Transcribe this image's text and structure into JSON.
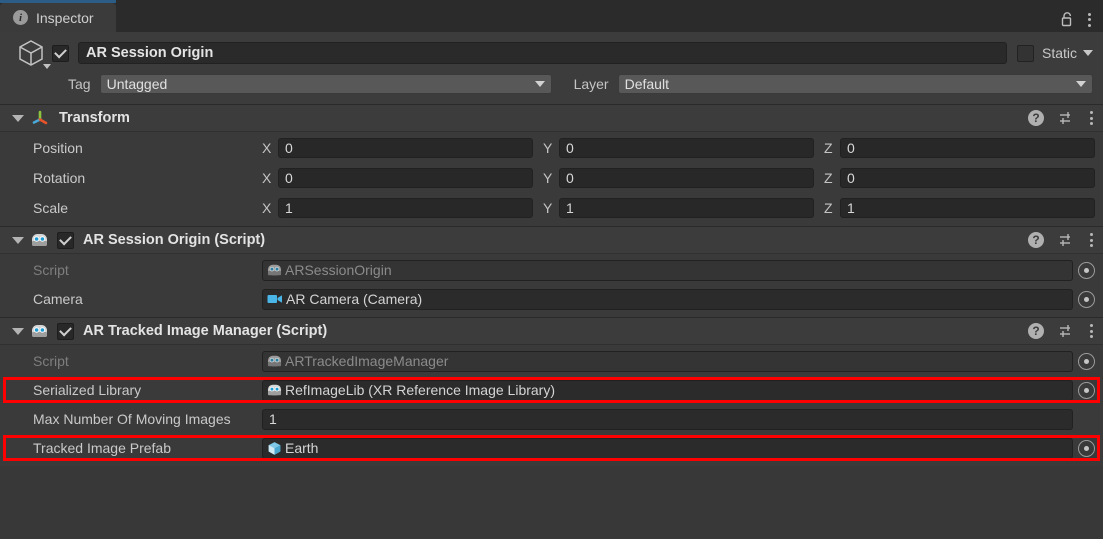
{
  "window": {
    "tab_label": "Inspector",
    "tab_icon": "info-icon",
    "lock_icon": "lock-icon",
    "menu_icon": "kebab-menu-icon"
  },
  "gameobject": {
    "enabled": true,
    "name": "AR Session Origin",
    "icon": "gameobject-cube-icon",
    "static_label": "Static",
    "static_checked": false,
    "tag_label": "Tag",
    "tag_value": "Untagged",
    "layer_label": "Layer",
    "layer_value": "Default"
  },
  "components": [
    {
      "title": "Transform",
      "icon": "transform-axis-icon",
      "has_enable_toggle": false,
      "help_icon": "help-icon",
      "preset_icon": "preset-sliders-icon",
      "menu_icon": "kebab-menu-icon",
      "rows": [
        {
          "type": "vector3",
          "label": "Position",
          "x": "0",
          "y": "0",
          "z": "0"
        },
        {
          "type": "vector3",
          "label": "Rotation",
          "x": "0",
          "y": "0",
          "z": "0"
        },
        {
          "type": "vector3",
          "label": "Scale",
          "x": "1",
          "y": "1",
          "z": "1"
        }
      ]
    },
    {
      "title": "AR Session Origin (Script)",
      "icon": "cs-script-icon",
      "has_enable_toggle": true,
      "enabled": true,
      "rows": [
        {
          "type": "object",
          "label": "Script",
          "value": "ARSessionOrigin",
          "value_icon": "cs-script-icon",
          "dim": true,
          "highlight": false
        },
        {
          "type": "object",
          "label": "Camera",
          "value": "AR Camera (Camera)",
          "value_icon": "camera-icon",
          "dim": false,
          "highlight": false
        }
      ]
    },
    {
      "title": "AR Tracked Image Manager (Script)",
      "icon": "cs-script-icon",
      "has_enable_toggle": true,
      "enabled": true,
      "rows": [
        {
          "type": "object",
          "label": "Script",
          "value": "ARTrackedImageManager",
          "value_icon": "cs-script-icon",
          "dim": true,
          "highlight": false
        },
        {
          "type": "object",
          "label": "Serialized Library",
          "value": "RefImageLib (XR Reference Image Library)",
          "value_icon": "cs-script-icon",
          "dim": false,
          "highlight": true
        },
        {
          "type": "number",
          "label": "Max Number Of Moving Images",
          "value": "1",
          "highlight": false
        },
        {
          "type": "object",
          "label": "Tracked Image Prefab",
          "value": "Earth",
          "value_icon": "prefab-icon",
          "dim": false,
          "highlight": true
        }
      ]
    }
  ],
  "colors": {
    "accent_blue": "#2c5d87",
    "highlight_red": "#ff0000",
    "panel_bg": "#383838",
    "header_bg": "#3c3c3c",
    "field_bg": "#282828"
  }
}
